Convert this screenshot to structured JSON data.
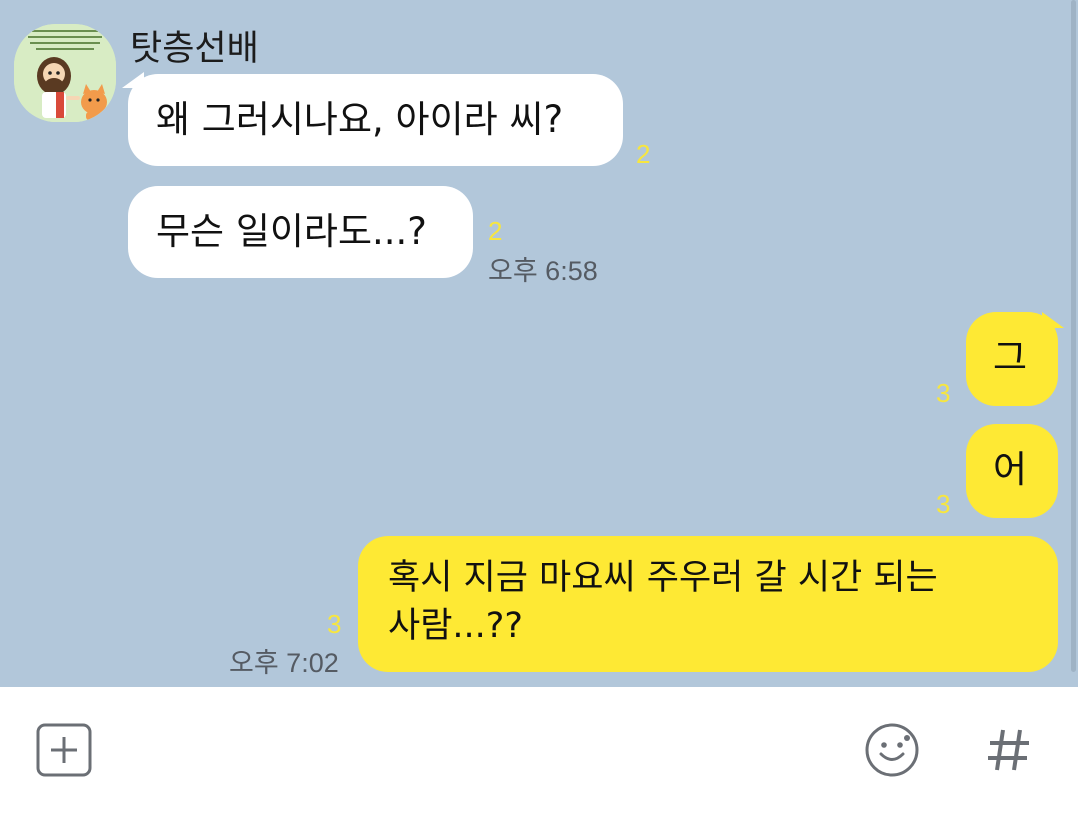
{
  "sender": {
    "name": "탓층선배",
    "avatar_icon": "character-avatar-icon"
  },
  "messages_in": [
    {
      "text": "왜 그러시나요, 아이라 씨?",
      "unread": "2"
    },
    {
      "text": "무슨 일이라도...?",
      "unread": "2",
      "time": "오후 6:58"
    }
  ],
  "messages_out": [
    {
      "text": "그",
      "unread": "3"
    },
    {
      "text": "어",
      "unread": "3"
    },
    {
      "line1": "혹시 지금 마요씨 주우러 갈 시간 되는",
      "line2": "사람...??",
      "unread": "3",
      "time": "오후 7:02"
    }
  ],
  "input_bar": {
    "add_icon": "plus-square-icon",
    "emoji_icon": "smiley-icon",
    "hash_icon": "hashtag-icon"
  },
  "colors": {
    "chat_bg": "#b2c7da",
    "my_bubble": "#fee934",
    "other_bubble": "#ffffff",
    "unread": "#f7e63f"
  }
}
